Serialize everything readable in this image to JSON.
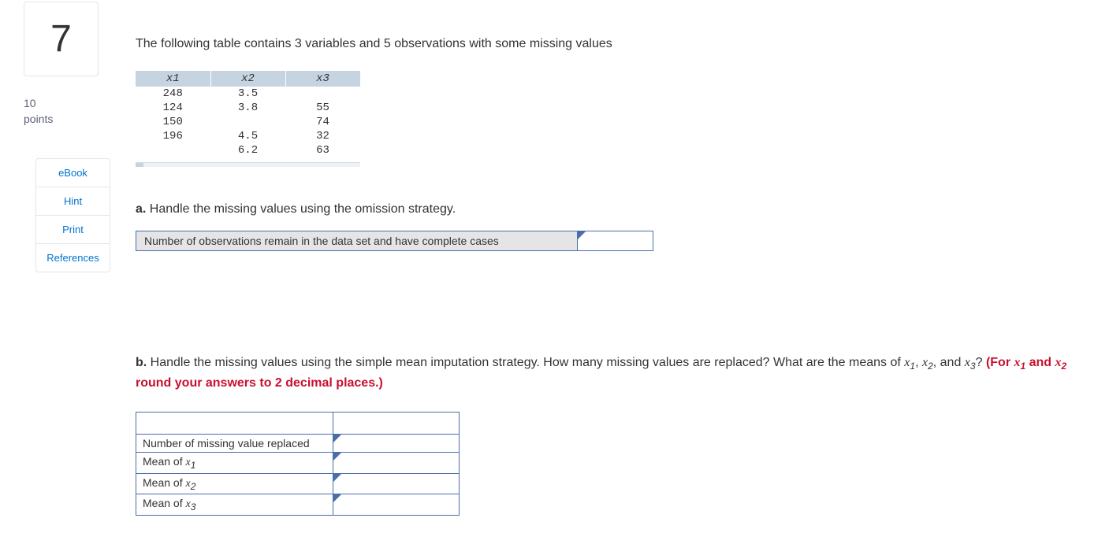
{
  "sidebar": {
    "question_number": "7",
    "points_value": "10",
    "points_label": "points",
    "links": [
      "eBook",
      "Hint",
      "Print",
      "References"
    ]
  },
  "intro_text": "The following table contains 3 variables and 5 observations with some missing values",
  "data_table": {
    "headers": [
      "x1",
      "x2",
      "x3"
    ],
    "rows": [
      [
        "248",
        "3.5",
        ""
      ],
      [
        "124",
        "3.8",
        "55"
      ],
      [
        "150",
        "",
        "74"
      ],
      [
        "196",
        "4.5",
        "32"
      ],
      [
        "",
        "6.2",
        "63"
      ]
    ]
  },
  "part_a": {
    "label": "a.",
    "text": " Handle the missing values using the omission strategy.",
    "prompt": "Number of observations remain in the data set and have complete cases",
    "value": ""
  },
  "part_b": {
    "label": "b.",
    "text_pre": " Handle the missing values using the simple mean imputation strategy. How many missing values are replaced? What are the means of ",
    "vars_join": ",  ",
    "and_text": ", and ",
    "q_mark": "? ",
    "note_pre": "(For ",
    "note_mid": " and ",
    "note_post": " round your answers to 2 decimal places.)",
    "rows": [
      {
        "label": "Number of missing value replaced",
        "value": ""
      },
      {
        "label_pre": "Mean of ",
        "var": "x",
        "sub": "1",
        "value": ""
      },
      {
        "label_pre": "Mean of ",
        "var": "x",
        "sub": "2",
        "value": ""
      },
      {
        "label_pre": "Mean of ",
        "var": "x",
        "sub": "3",
        "value": ""
      }
    ]
  },
  "vars": {
    "x": "x",
    "s1": "1",
    "s2": "2",
    "s3": "3"
  }
}
